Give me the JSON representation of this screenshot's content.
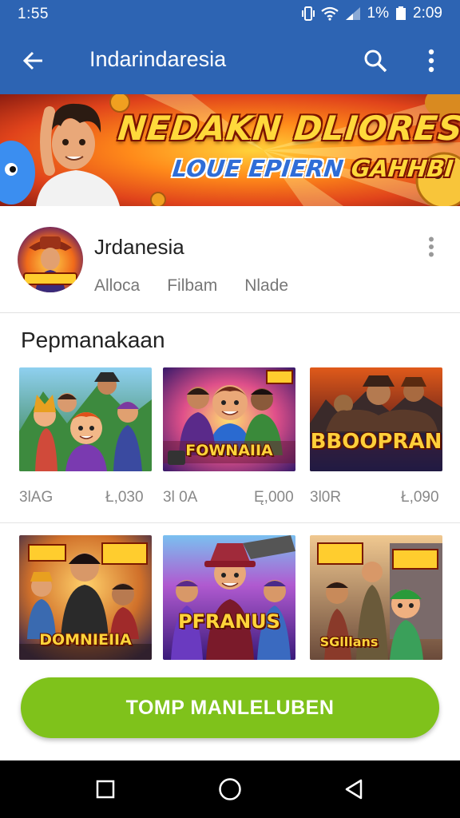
{
  "status_bar": {
    "time_left": "1:55",
    "battery": "1%",
    "time_right": "2:09"
  },
  "app_bar": {
    "title": "Indarindaresia"
  },
  "banner": {
    "headline": "NEDAKN DLIORES",
    "sub_left": "LOUE EPIERN",
    "sub_right": "GAHHBI"
  },
  "channel": {
    "name": "Jrdanesia",
    "tabs": [
      "Alloca",
      "Filbam",
      "Nlade"
    ]
  },
  "section": {
    "title": "Pepmanakaan"
  },
  "games_row1": [
    {
      "caption": "",
      "count": "3lAG",
      "price": "Ł,030"
    },
    {
      "caption": "FOWNAIIA",
      "count": "3l 0A",
      "price": "Ę,000"
    },
    {
      "caption": "BBOOPRAN",
      "count": "3l0R",
      "price": "Ł,090"
    }
  ],
  "games_row2": [
    {
      "caption": "DOMNIEIIA"
    },
    {
      "caption": "PFRANUS"
    },
    {
      "caption": "SGlllans"
    }
  ],
  "cta": {
    "label": "TOMP MANLELUBEN"
  },
  "colors": {
    "app_bar": "#2d64b3",
    "cta": "#7fc21b",
    "nav_bar": "#000000"
  }
}
